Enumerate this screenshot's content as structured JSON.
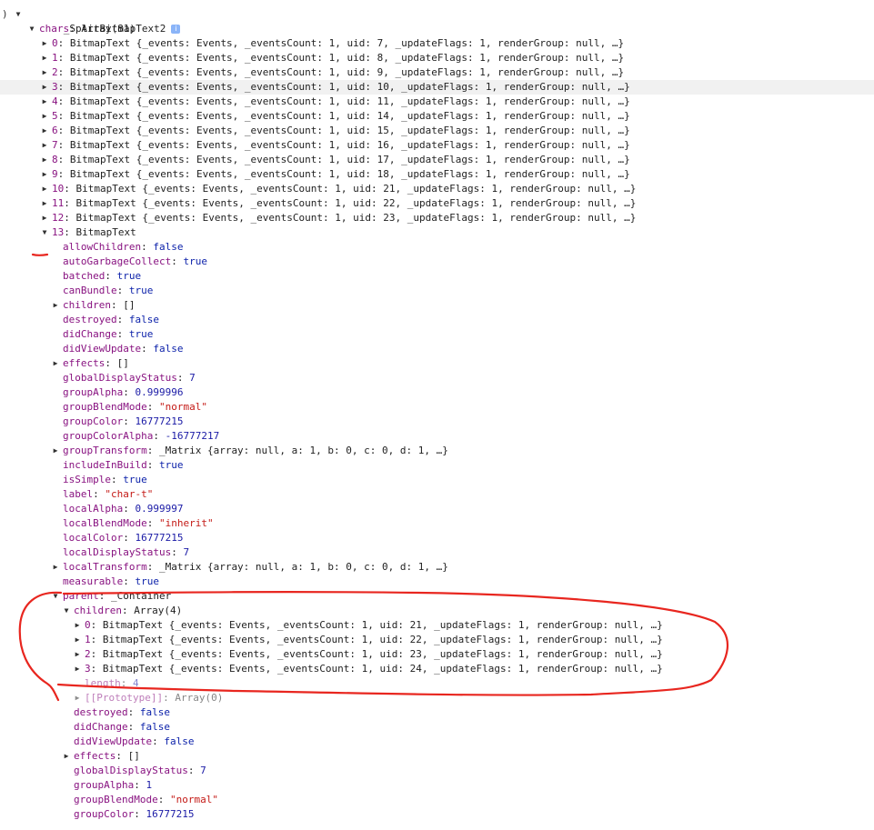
{
  "lead_char": ")",
  "root": {
    "name": "_SplitBitmapText2",
    "info_icon": "i"
  },
  "rows": [
    {
      "indent": 0,
      "tri": "open",
      "parts": [
        [
          "k",
          "chars"
        ],
        [
          "p",
          ": "
        ],
        [
          "t",
          "Array(81)"
        ]
      ]
    },
    {
      "indent": 1,
      "tri": "closed",
      "parts": [
        [
          "k",
          "0"
        ],
        [
          "p",
          ": "
        ],
        [
          "t",
          "BitmapText {_events: Events, _eventsCount: 1, uid: 7, _updateFlags: 1, renderGroup: null, …}"
        ]
      ]
    },
    {
      "indent": 1,
      "tri": "closed",
      "parts": [
        [
          "k",
          "1"
        ],
        [
          "p",
          ": "
        ],
        [
          "t",
          "BitmapText {_events: Events, _eventsCount: 1, uid: 8, _updateFlags: 1, renderGroup: null, …}"
        ]
      ]
    },
    {
      "indent": 1,
      "tri": "closed",
      "parts": [
        [
          "k",
          "2"
        ],
        [
          "p",
          ": "
        ],
        [
          "t",
          "BitmapText {_events: Events, _eventsCount: 1, uid: 9, _updateFlags: 1, renderGroup: null, …}"
        ]
      ]
    },
    {
      "indent": 1,
      "tri": "closed",
      "hl": true,
      "parts": [
        [
          "k",
          "3"
        ],
        [
          "p",
          ": "
        ],
        [
          "t",
          "BitmapText {_events: Events, _eventsCount: 1, uid: 10, _updateFlags: 1, renderGroup: null, …}"
        ]
      ]
    },
    {
      "indent": 1,
      "tri": "closed",
      "parts": [
        [
          "k",
          "4"
        ],
        [
          "p",
          ": "
        ],
        [
          "t",
          "BitmapText {_events: Events, _eventsCount: 1, uid: 11, _updateFlags: 1, renderGroup: null, …}"
        ]
      ]
    },
    {
      "indent": 1,
      "tri": "closed",
      "parts": [
        [
          "k",
          "5"
        ],
        [
          "p",
          ": "
        ],
        [
          "t",
          "BitmapText {_events: Events, _eventsCount: 1, uid: 14, _updateFlags: 1, renderGroup: null, …}"
        ]
      ]
    },
    {
      "indent": 1,
      "tri": "closed",
      "parts": [
        [
          "k",
          "6"
        ],
        [
          "p",
          ": "
        ],
        [
          "t",
          "BitmapText {_events: Events, _eventsCount: 1, uid: 15, _updateFlags: 1, renderGroup: null, …}"
        ]
      ]
    },
    {
      "indent": 1,
      "tri": "closed",
      "parts": [
        [
          "k",
          "7"
        ],
        [
          "p",
          ": "
        ],
        [
          "t",
          "BitmapText {_events: Events, _eventsCount: 1, uid: 16, _updateFlags: 1, renderGroup: null, …}"
        ]
      ]
    },
    {
      "indent": 1,
      "tri": "closed",
      "parts": [
        [
          "k",
          "8"
        ],
        [
          "p",
          ": "
        ],
        [
          "t",
          "BitmapText {_events: Events, _eventsCount: 1, uid: 17, _updateFlags: 1, renderGroup: null, …}"
        ]
      ]
    },
    {
      "indent": 1,
      "tri": "closed",
      "parts": [
        [
          "k",
          "9"
        ],
        [
          "p",
          ": "
        ],
        [
          "t",
          "BitmapText {_events: Events, _eventsCount: 1, uid: 18, _updateFlags: 1, renderGroup: null, …}"
        ]
      ]
    },
    {
      "indent": 1,
      "tri": "closed",
      "parts": [
        [
          "k",
          "10"
        ],
        [
          "p",
          ": "
        ],
        [
          "t",
          "BitmapText {_events: Events, _eventsCount: 1, uid: 21, _updateFlags: 1, renderGroup: null, …}"
        ]
      ]
    },
    {
      "indent": 1,
      "tri": "closed",
      "parts": [
        [
          "k",
          "11"
        ],
        [
          "p",
          ": "
        ],
        [
          "t",
          "BitmapText {_events: Events, _eventsCount: 1, uid: 22, _updateFlags: 1, renderGroup: null, …}"
        ]
      ]
    },
    {
      "indent": 1,
      "tri": "closed",
      "parts": [
        [
          "k",
          "12"
        ],
        [
          "p",
          ": "
        ],
        [
          "t",
          "BitmapText {_events: Events, _eventsCount: 1, uid: 23, _updateFlags: 1, renderGroup: null, …}"
        ]
      ]
    },
    {
      "indent": 1,
      "tri": "open",
      "parts": [
        [
          "k",
          "13"
        ],
        [
          "p",
          ": "
        ],
        [
          "t",
          "BitmapText"
        ]
      ]
    },
    {
      "indent": 2,
      "parts": [
        [
          "k",
          "allowChildren"
        ],
        [
          "p",
          ": "
        ],
        [
          "kw",
          "false"
        ]
      ]
    },
    {
      "indent": 2,
      "parts": [
        [
          "k",
          "autoGarbageCollect"
        ],
        [
          "p",
          ": "
        ],
        [
          "kw",
          "true"
        ]
      ]
    },
    {
      "indent": 2,
      "parts": [
        [
          "k",
          "batched"
        ],
        [
          "p",
          ": "
        ],
        [
          "kw",
          "true"
        ]
      ]
    },
    {
      "indent": 2,
      "parts": [
        [
          "k",
          "canBundle"
        ],
        [
          "p",
          ": "
        ],
        [
          "kw",
          "true"
        ]
      ]
    },
    {
      "indent": 2,
      "tri": "closed",
      "parts": [
        [
          "k",
          "children"
        ],
        [
          "p",
          ": "
        ],
        [
          "t",
          "[]"
        ]
      ]
    },
    {
      "indent": 2,
      "parts": [
        [
          "k",
          "destroyed"
        ],
        [
          "p",
          ": "
        ],
        [
          "kw",
          "false"
        ]
      ]
    },
    {
      "indent": 2,
      "parts": [
        [
          "k",
          "didChange"
        ],
        [
          "p",
          ": "
        ],
        [
          "kw",
          "true"
        ]
      ]
    },
    {
      "indent": 2,
      "parts": [
        [
          "k",
          "didViewUpdate"
        ],
        [
          "p",
          ": "
        ],
        [
          "kw",
          "false"
        ]
      ]
    },
    {
      "indent": 2,
      "tri": "closed",
      "parts": [
        [
          "k",
          "effects"
        ],
        [
          "p",
          ": "
        ],
        [
          "t",
          "[]"
        ]
      ]
    },
    {
      "indent": 2,
      "parts": [
        [
          "k",
          "globalDisplayStatus"
        ],
        [
          "p",
          ": "
        ],
        [
          "n",
          "7"
        ]
      ]
    },
    {
      "indent": 2,
      "parts": [
        [
          "k",
          "groupAlpha"
        ],
        [
          "p",
          ": "
        ],
        [
          "n",
          "0.999996"
        ]
      ]
    },
    {
      "indent": 2,
      "parts": [
        [
          "k",
          "groupBlendMode"
        ],
        [
          "p",
          ": "
        ],
        [
          "s",
          "\"normal\""
        ]
      ]
    },
    {
      "indent": 2,
      "parts": [
        [
          "k",
          "groupColor"
        ],
        [
          "p",
          ": "
        ],
        [
          "n",
          "16777215"
        ]
      ]
    },
    {
      "indent": 2,
      "parts": [
        [
          "k",
          "groupColorAlpha"
        ],
        [
          "p",
          ": "
        ],
        [
          "n",
          "-16777217"
        ]
      ]
    },
    {
      "indent": 2,
      "tri": "closed",
      "parts": [
        [
          "k",
          "groupTransform"
        ],
        [
          "p",
          ": "
        ],
        [
          "t",
          "_Matrix {array: null, a: 1, b: 0, c: 0, d: 1, …}"
        ]
      ]
    },
    {
      "indent": 2,
      "parts": [
        [
          "k",
          "includeInBuild"
        ],
        [
          "p",
          ": "
        ],
        [
          "kw",
          "true"
        ]
      ]
    },
    {
      "indent": 2,
      "parts": [
        [
          "k",
          "isSimple"
        ],
        [
          "p",
          ": "
        ],
        [
          "kw",
          "true"
        ]
      ]
    },
    {
      "indent": 2,
      "parts": [
        [
          "k",
          "label"
        ],
        [
          "p",
          ": "
        ],
        [
          "s",
          "\"char-t\""
        ]
      ]
    },
    {
      "indent": 2,
      "parts": [
        [
          "k",
          "localAlpha"
        ],
        [
          "p",
          ": "
        ],
        [
          "n",
          "0.999997"
        ]
      ]
    },
    {
      "indent": 2,
      "parts": [
        [
          "k",
          "localBlendMode"
        ],
        [
          "p",
          ": "
        ],
        [
          "s",
          "\"inherit\""
        ]
      ]
    },
    {
      "indent": 2,
      "parts": [
        [
          "k",
          "localColor"
        ],
        [
          "p",
          ": "
        ],
        [
          "n",
          "16777215"
        ]
      ]
    },
    {
      "indent": 2,
      "parts": [
        [
          "k",
          "localDisplayStatus"
        ],
        [
          "p",
          ": "
        ],
        [
          "n",
          "7"
        ]
      ]
    },
    {
      "indent": 2,
      "tri": "closed",
      "parts": [
        [
          "k",
          "localTransform"
        ],
        [
          "p",
          ": "
        ],
        [
          "t",
          "_Matrix {array: null, a: 1, b: 0, c: 0, d: 1, …}"
        ]
      ]
    },
    {
      "indent": 2,
      "parts": [
        [
          "k",
          "measurable"
        ],
        [
          "p",
          ": "
        ],
        [
          "kw",
          "true"
        ]
      ]
    },
    {
      "indent": 2,
      "tri": "open",
      "parts": [
        [
          "k",
          "parent"
        ],
        [
          "p",
          ": "
        ],
        [
          "t",
          "_Container"
        ]
      ]
    },
    {
      "indent": 3,
      "tri": "open",
      "parts": [
        [
          "k",
          "children"
        ],
        [
          "p",
          ": "
        ],
        [
          "t",
          "Array(4)"
        ]
      ]
    },
    {
      "indent": 4,
      "tri": "closed",
      "parts": [
        [
          "k",
          "0"
        ],
        [
          "p",
          ": "
        ],
        [
          "t",
          "BitmapText {_events: Events, _eventsCount: 1, uid: 21, _updateFlags: 1, renderGroup: null, …}"
        ]
      ]
    },
    {
      "indent": 4,
      "tri": "closed",
      "parts": [
        [
          "k",
          "1"
        ],
        [
          "p",
          ": "
        ],
        [
          "t",
          "BitmapText {_events: Events, _eventsCount: 1, uid: 22, _updateFlags: 1, renderGroup: null, …}"
        ]
      ]
    },
    {
      "indent": 4,
      "tri": "closed",
      "parts": [
        [
          "k",
          "2"
        ],
        [
          "p",
          ": "
        ],
        [
          "t",
          "BitmapText {_events: Events, _eventsCount: 1, uid: 23, _updateFlags: 1, renderGroup: null, …}"
        ]
      ]
    },
    {
      "indent": 4,
      "tri": "closed",
      "parts": [
        [
          "k",
          "3"
        ],
        [
          "p",
          ": "
        ],
        [
          "t",
          "BitmapText {_events: Events, _eventsCount: 1, uid: 24, _updateFlags: 1, renderGroup: null, …}"
        ]
      ]
    },
    {
      "indent": 4,
      "dim": true,
      "parts": [
        [
          "k",
          "length"
        ],
        [
          "p",
          ": "
        ],
        [
          "n",
          "4"
        ]
      ]
    },
    {
      "indent": 4,
      "tri": "closed",
      "dim": true,
      "parts": [
        [
          "k",
          "[[Prototype]]"
        ],
        [
          "p",
          ": "
        ],
        [
          "t",
          "Array(0)"
        ]
      ]
    },
    {
      "indent": 3,
      "parts": [
        [
          "k",
          "destroyed"
        ],
        [
          "p",
          ": "
        ],
        [
          "kw",
          "false"
        ]
      ]
    },
    {
      "indent": 3,
      "parts": [
        [
          "k",
          "didChange"
        ],
        [
          "p",
          ": "
        ],
        [
          "kw",
          "false"
        ]
      ]
    },
    {
      "indent": 3,
      "parts": [
        [
          "k",
          "didViewUpdate"
        ],
        [
          "p",
          ": "
        ],
        [
          "kw",
          "false"
        ]
      ]
    },
    {
      "indent": 3,
      "tri": "closed",
      "parts": [
        [
          "k",
          "effects"
        ],
        [
          "p",
          ": "
        ],
        [
          "t",
          "[]"
        ]
      ]
    },
    {
      "indent": 3,
      "parts": [
        [
          "k",
          "globalDisplayStatus"
        ],
        [
          "p",
          ": "
        ],
        [
          "n",
          "7"
        ]
      ]
    },
    {
      "indent": 3,
      "parts": [
        [
          "k",
          "groupAlpha"
        ],
        [
          "p",
          ": "
        ],
        [
          "n",
          "1"
        ]
      ]
    },
    {
      "indent": 3,
      "parts": [
        [
          "k",
          "groupBlendMode"
        ],
        [
          "p",
          ": "
        ],
        [
          "s",
          "\"normal\""
        ]
      ]
    },
    {
      "indent": 3,
      "parts": [
        [
          "k",
          "groupColor"
        ],
        [
          "p",
          ": "
        ],
        [
          "n",
          "16777215"
        ]
      ]
    }
  ],
  "annotation_color": "#e8261f"
}
